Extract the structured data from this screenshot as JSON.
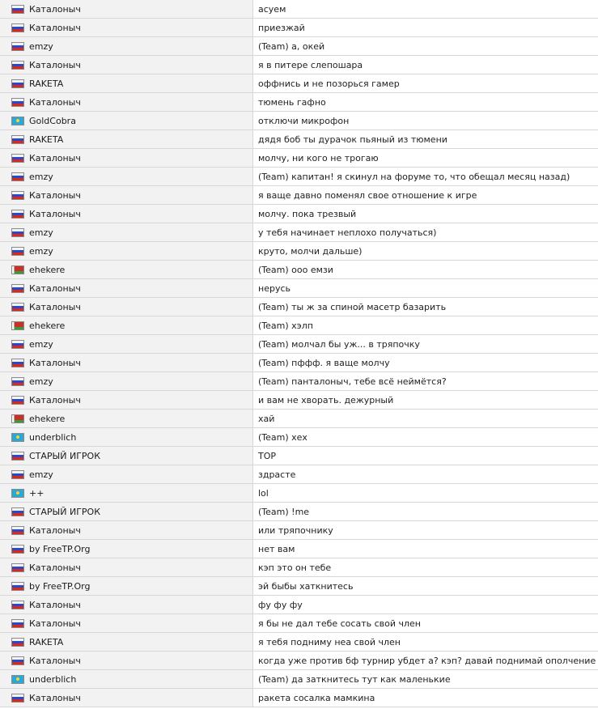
{
  "rows": [
    {
      "flag": "ru",
      "player": "Каталоныч",
      "message": "асуем"
    },
    {
      "flag": "ru",
      "player": "Каталоныч",
      "message": "приезжай"
    },
    {
      "flag": "ru",
      "player": "emzy",
      "message": "(Team) а, окей"
    },
    {
      "flag": "ru",
      "player": "Каталоныч",
      "message": "я в питере слепошара"
    },
    {
      "flag": "ru",
      "player": "RAKETA",
      "message": "оффнись и не позорься гамер"
    },
    {
      "flag": "ru",
      "player": "Каталоныч",
      "message": "тюмень гафно"
    },
    {
      "flag": "kz",
      "player": "GoldCobra",
      "message": "отключи микрофон"
    },
    {
      "flag": "ru",
      "player": "RAKETA",
      "message": "дядя боб ты дурачок пьяный из тюмени"
    },
    {
      "flag": "ru",
      "player": "Каталоныч",
      "message": "молчу, ни кого не трогаю"
    },
    {
      "flag": "ru",
      "player": "emzy",
      "message": "(Team) капитан! я скинул на форуме то, что обещал месяц назад)"
    },
    {
      "flag": "ru",
      "player": "Каталоныч",
      "message": "я ваще давно поменял свое отношение к игре"
    },
    {
      "flag": "ru",
      "player": "Каталоныч",
      "message": "молчу. пока трезвый"
    },
    {
      "flag": "ru",
      "player": "emzy",
      "message": "у тебя начинает неплохо получаться)"
    },
    {
      "flag": "ru",
      "player": "emzy",
      "message": "круто, молчи дальше)"
    },
    {
      "flag": "by",
      "player": "ehekere",
      "message": "(Team) ооо емзи"
    },
    {
      "flag": "ru",
      "player": "Каталоныч",
      "message": "нерусь"
    },
    {
      "flag": "ru",
      "player": "Каталоныч",
      "message": "(Team) ты ж за спиной масетр базарить"
    },
    {
      "flag": "by",
      "player": "ehekere",
      "message": "(Team) хэлп"
    },
    {
      "flag": "ru",
      "player": "emzy",
      "message": "(Team) молчал бы уж... в тряпочку"
    },
    {
      "flag": "ru",
      "player": "Каталоныч",
      "message": "(Team) пффф. я ваще молчу"
    },
    {
      "flag": "ru",
      "player": "emzy",
      "message": "(Team) панталоныч, тебе всё неймётся?"
    },
    {
      "flag": "ru",
      "player": "Каталоныч",
      "message": "и вам не хворать. дежурный"
    },
    {
      "flag": "by",
      "player": "ehekere",
      "message": "хай"
    },
    {
      "flag": "kz",
      "player": "underblich",
      "message": "(Team) хех"
    },
    {
      "flag": "ru",
      "player": "СТАРЫЙ ИГРОК",
      "message": "ТОР"
    },
    {
      "flag": "ru",
      "player": "emzy",
      "message": "здрасте"
    },
    {
      "flag": "kz",
      "player": "++",
      "message": "lol"
    },
    {
      "flag": "ru",
      "player": "СТАРЫЙ ИГРОК",
      "message": "(Team) !me"
    },
    {
      "flag": "ru",
      "player": "Каталоныч",
      "message": "или тряпочнику"
    },
    {
      "flag": "ru",
      "player": "by FreeTP.Org",
      "message": "нет вам"
    },
    {
      "flag": "ru",
      "player": "Каталоныч",
      "message": "кэп это он тебе"
    },
    {
      "flag": "ru",
      "player": "by FreeTP.Org",
      "message": "эй быбы хаткнитесь"
    },
    {
      "flag": "ru",
      "player": "Каталоныч",
      "message": "фу фу фу"
    },
    {
      "flag": "ru",
      "player": "Каталоныч",
      "message": "я бы не дал тебе сосать свой член"
    },
    {
      "flag": "ru",
      "player": "RAKETA",
      "message": "я тебя подниму неа свой член"
    },
    {
      "flag": "ru",
      "player": "Каталоныч",
      "message": "когда уже против бф турнир убдет а? кэп? давай поднимай ополчение"
    },
    {
      "flag": "kz",
      "player": "underblich",
      "message": "(Team) да заткнитесь тут как маленькие"
    },
    {
      "flag": "ru",
      "player": "Каталоныч",
      "message": "ракета сосалка мамкина"
    }
  ]
}
